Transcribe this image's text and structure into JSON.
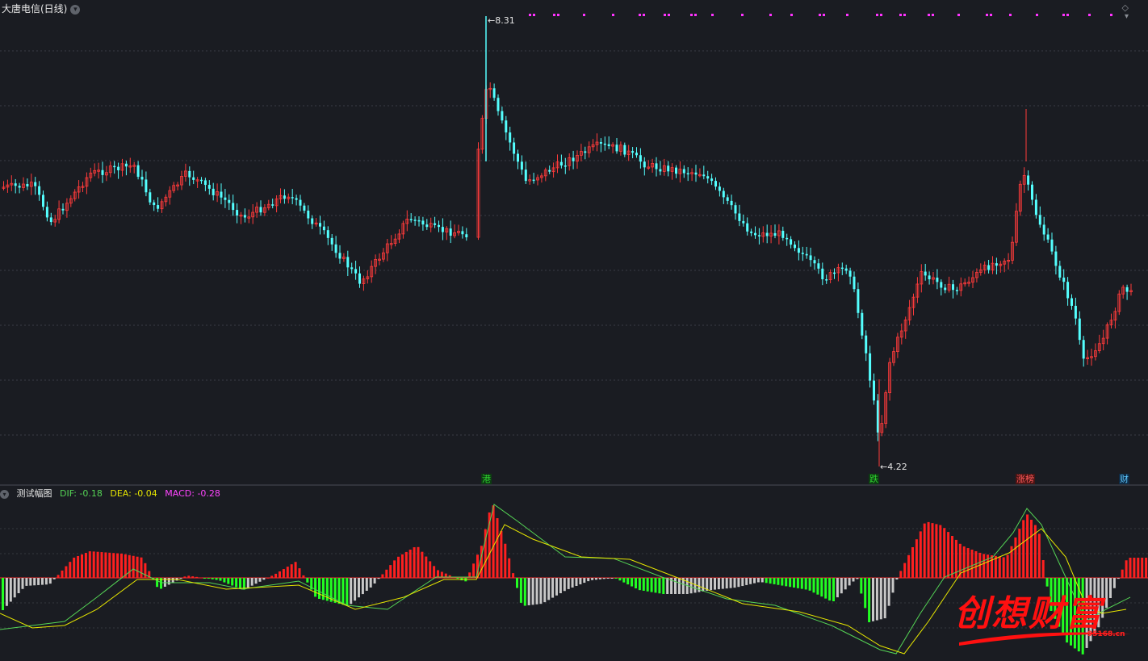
{
  "header": {
    "title": "大唐电信(日线)",
    "menu_icon": "chevron-down-icon",
    "corner_icon": "diamond-icon"
  },
  "price_labels": {
    "high": "8.31",
    "low": "4.22"
  },
  "events": [
    {
      "label": "港",
      "kind": "g"
    },
    {
      "label": "跌",
      "kind": "g"
    },
    {
      "label": "涨榜",
      "kind": "r"
    },
    {
      "label": "财",
      "kind": "b"
    }
  ],
  "indicator": {
    "name": "测试幅图",
    "dif_label": "DIF: -0.18",
    "dea_label": "DEA: -0.04",
    "macd_label": "MACD: -0.28"
  },
  "watermark": {
    "text": "创想财富",
    "site": "95168.cn"
  },
  "colors": {
    "background": "#1a1c22",
    "up": "#ff3b3b",
    "down": "#54ffff",
    "dif": "#55d455",
    "dea": "#e6e600",
    "macd_label": "#ff44ff",
    "bar_up": "#ff2020",
    "bar_down": "#22ff22",
    "bar_gray": "#c8c8c8"
  }
}
